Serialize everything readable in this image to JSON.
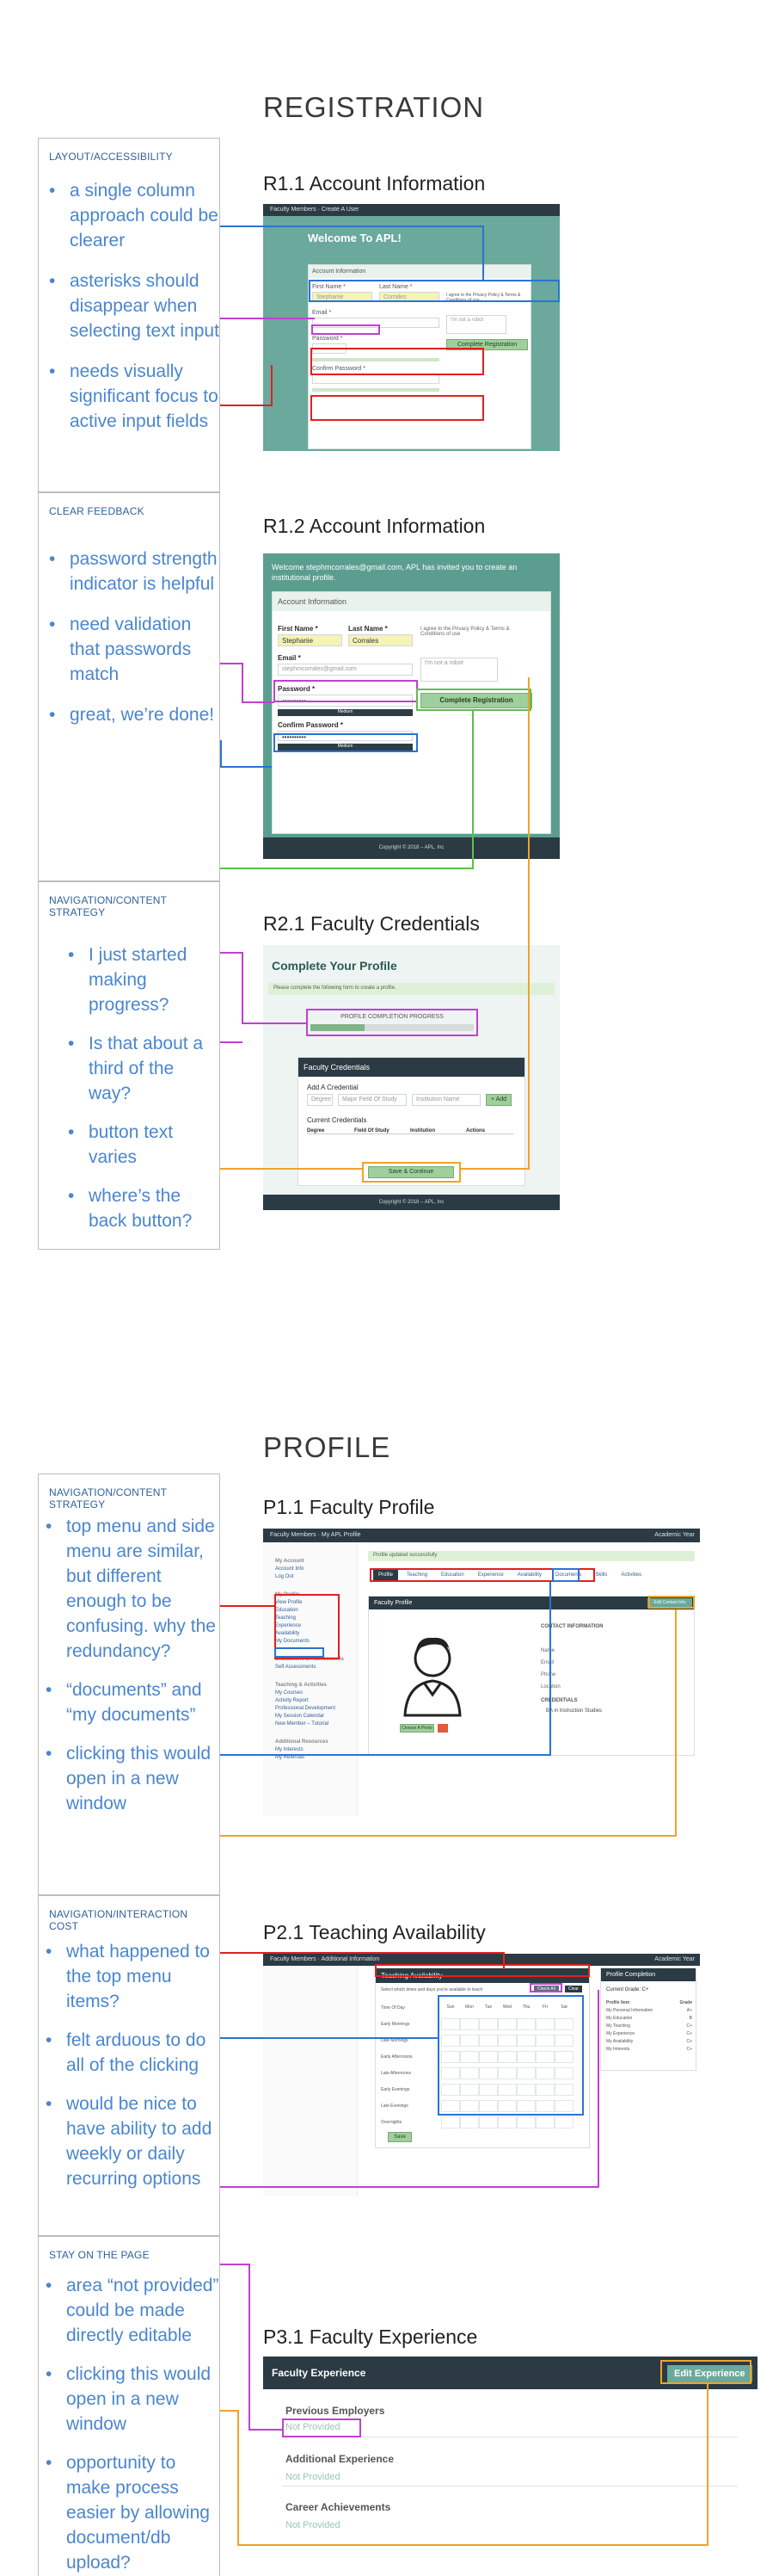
{
  "sections": {
    "registration": "REGISTRATION",
    "profile": "PROFILE"
  },
  "panels": [
    {
      "title": "LAYOUT/ACCESSIBILITY",
      "bullets": [
        "a single column approach could be clearer",
        "asterisks should disappear when selecting text input",
        "needs visually significant focus to active input fields"
      ]
    },
    {
      "title": "CLEAR FEEDBACK",
      "bullets": [
        "password strength indicator is helpful",
        "need validation that passwords match",
        "great, we’re done!"
      ]
    },
    {
      "title": "NAVIGATION/CONTENT STRATEGY",
      "bullets": [
        "I just started making progress?",
        "Is that about a third of the way?",
        "button text varies",
        "where’s the back button?"
      ]
    },
    {
      "title": "NAVIGATION/CONTENT STRATEGY",
      "bullets": [
        "top menu and side menu are similar, but different enough to be confusing. why the redundancy?",
        "“documents” and “my documents”",
        "clicking this would open in a new window"
      ]
    },
    {
      "title": "NAVIGATION/INTERACTION COST",
      "bullets": [
        "what happened to the top menu items?",
        "felt arduous to do all of the clicking",
        "would be nice to have ability to add weekly or daily recurring options"
      ]
    },
    {
      "title": "STAY ON THE PAGE",
      "bullets": [
        "area “not provided” could be made directly editable",
        "clicking this would open in a new window",
        "opportunity to make process easier by allowing document/db upload?"
      ]
    }
  ],
  "screens": {
    "r11": {
      "label": "R1.1 Account Information",
      "topbar": "Faculty Members · Create A User",
      "welcome": "Welcome To APL!",
      "section": "Account Information",
      "first_name": "First Name *",
      "last_name": "Last Name *",
      "first_val": "Stephanie",
      "last_val": "Corrales",
      "email": "Email *",
      "password": "Password *",
      "confirm": "Confirm Password *",
      "captcha": "I'm not a robot",
      "agree": "I agree to the Privacy Policy & Terms & Conditions of use",
      "button": "Complete Registration"
    },
    "r12": {
      "label": "R1.2 Account Information",
      "intro": "Welcome stephmcorrales@gmail.com, APL has invited you to create an institutional profile.",
      "section": "Account Information",
      "first_name": "First Name *",
      "last_name": "Last Name *",
      "first_val": "Stephanie",
      "last_val": "Corrales",
      "agree": "I agree to the Privacy Policy & Terms & Conditions of use",
      "email": "Email *",
      "email_val": "stephmcorrales@gmail.com",
      "captcha": "I'm not a robot",
      "password": "Password *",
      "pw_val": "••••••••••",
      "confirm": "Confirm Password *",
      "meter1": "Medium",
      "meter2": "Medium",
      "button": "Complete Registration",
      "footer": "Copyright © 2018 – APL, Inc"
    },
    "r21": {
      "label": "R2.1 Faculty Credentials",
      "heading": "Complete Your Profile",
      "notice": "Please complete the following form to create a profile.",
      "progress": "PROFILE COMPLETION PROGRESS",
      "progress_value": 0.33,
      "card_title": "Faculty Credentials",
      "add": "Add A Credential",
      "deg": "Degree",
      "major": "Major Field Of Study",
      "inst": "Institution Name",
      "add_btn": "+ Add",
      "current": "Current Credentials",
      "cols": [
        "Degree",
        "Field Of Study",
        "Institution",
        "Actions"
      ],
      "button": "Save & Continue",
      "footer": "Copyright © 2018 – APL, Inc"
    },
    "p11": {
      "label": "P1.1 Faculty Profile",
      "topbar": "Faculty Members · My APL Profile",
      "year": "Academic Year",
      "notice": "Profile updated successfully",
      "tabs": [
        "Profile",
        "Teaching",
        "Education",
        "Experience",
        "Availability",
        "Documents",
        "Skills",
        "Activities"
      ],
      "card": "Faculty Profile",
      "edit": "Edit Contact Info",
      "contact": "CONTACT INFORMATION",
      "fields": [
        "Name",
        "Email",
        "Phone",
        "Location"
      ],
      "credentials": "CREDENTIALS",
      "cred_item": "BA in Instruction Studies",
      "photo_btn": "Choose A Photo",
      "side_groups": [
        {
          "head": "My Account",
          "items": [
            "Account Info",
            "Log Out"
          ]
        },
        {
          "head": "My Profile",
          "items": [
            "View Profile",
            "Education",
            "Teaching",
            "Experience",
            "Availability",
            "My Documents"
          ]
        },
        {
          "head": "Evaluations & Assessments",
          "items": [
            "Self Assessments"
          ]
        },
        {
          "head": "Teaching & Activities",
          "items": [
            "My Courses",
            "Activity Report",
            "Professional Development",
            "My Session Calendar",
            "New Member – Tutorial"
          ]
        },
        {
          "head": "Additional Resources",
          "items": [
            "My Interests",
            "My Referrals"
          ]
        }
      ]
    },
    "p21": {
      "label": "P2.1 Teaching Availability",
      "topbar": "Faculty Members · Additional Information",
      "year": "Academic Year",
      "card": "Teaching Availability",
      "hint": "Select which times and days you're available to teach",
      "check_all": "Check All",
      "clear": "Clear",
      "days": [
        "Sun",
        "Mon",
        "Tue",
        "Wed",
        "Thu",
        "Fri",
        "Sat"
      ],
      "times": [
        "Time Of Day",
        "Early Mornings",
        "Late Mornings",
        "Early Afternoons",
        "Late Afternoons",
        "Early Evenings",
        "Late Evenings",
        "Overnights"
      ],
      "save": "Save",
      "completion": "Profile Completion",
      "grade": "Current Grade: C+",
      "comp_head": [
        "Profile Item",
        "Grade"
      ],
      "comp_rows": [
        [
          "My Personal Information",
          "A+"
        ],
        [
          "My Education",
          "B"
        ],
        [
          "My Teaching",
          "C+"
        ],
        [
          "My Experience",
          "C+"
        ],
        [
          "My Availability",
          "C+"
        ],
        [
          "My Interests",
          "C+"
        ]
      ]
    },
    "p31": {
      "label": "P3.1 Faculty Experience",
      "header": "Faculty Experience",
      "edit": "Edit Experience",
      "blocks": [
        {
          "title": "Previous Employers",
          "value": "Not Provided"
        },
        {
          "title": "Additional Experience",
          "value": "Not Provided"
        },
        {
          "title": "Career Achievements",
          "value": "Not Provided"
        }
      ]
    }
  }
}
